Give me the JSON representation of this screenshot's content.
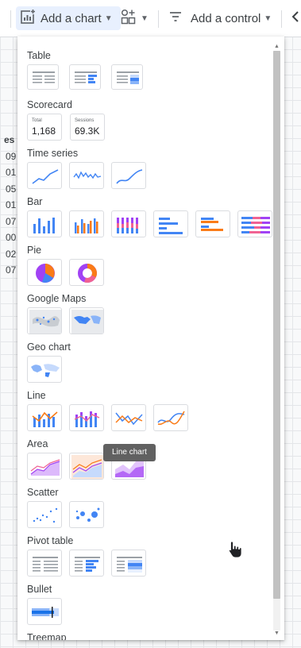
{
  "toolbar": {
    "add_chart": "Add a chart",
    "add_control": "Add a control"
  },
  "background_table": {
    "header": "es",
    "rows": [
      "09",
      "01",
      "05",
      "01",
      "07",
      "00",
      "02",
      "07"
    ]
  },
  "menu": {
    "sections": {
      "table": "Table",
      "scorecard": "Scorecard",
      "time_series": "Time series",
      "bar": "Bar",
      "pie": "Pie",
      "google_maps": "Google Maps",
      "geo_chart": "Geo chart",
      "line": "Line",
      "area": "Area",
      "scatter": "Scatter",
      "pivot_table": "Pivot table",
      "bullet": "Bullet",
      "treemap": "Treemap"
    },
    "scorecards": [
      {
        "label": "Total",
        "value": "1,168"
      },
      {
        "label": "Sessions",
        "value": "69.3K"
      }
    ],
    "tooltip": "Line chart"
  },
  "colors": {
    "blue": "#4285f4",
    "orange": "#fa7b17",
    "purple": "#a142f4",
    "light_purple": "#c58af9",
    "pink": "#f06292"
  }
}
